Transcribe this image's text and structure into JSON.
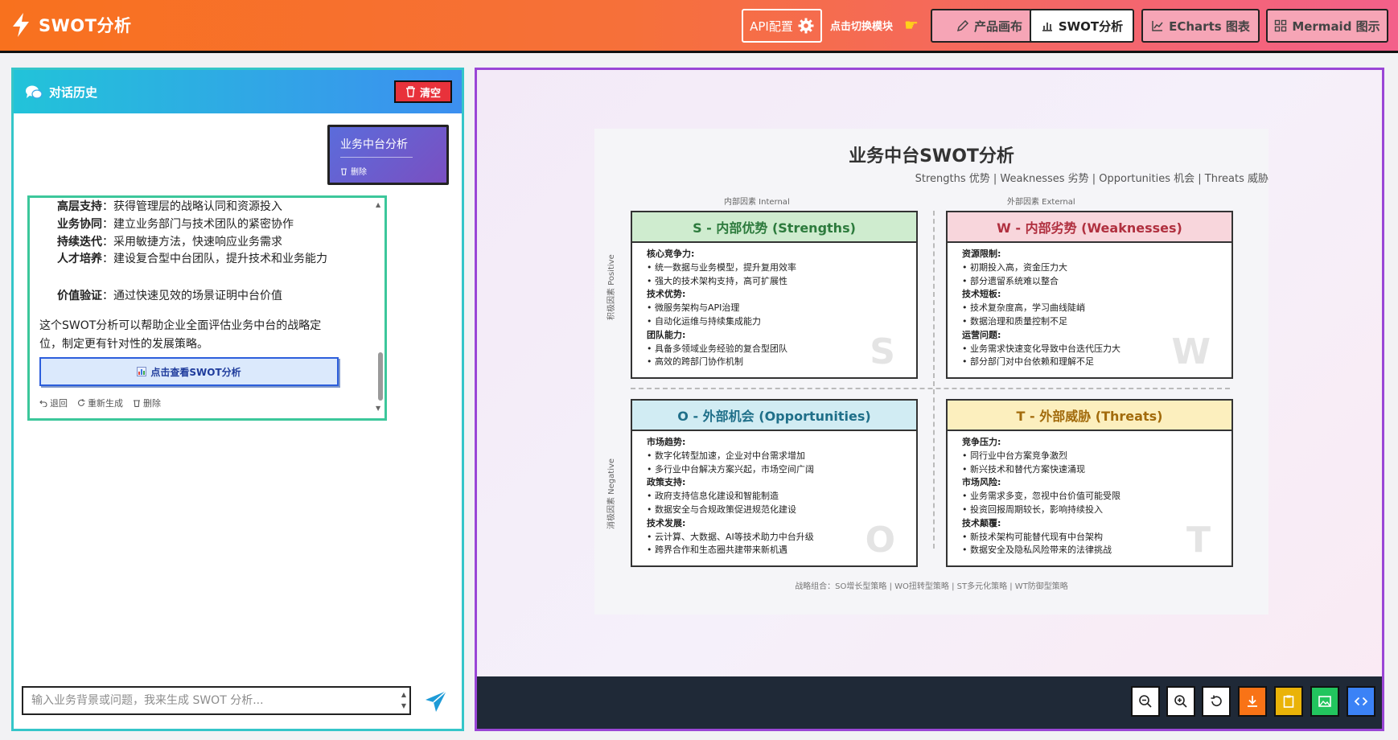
{
  "header": {
    "title": "SWOT分析",
    "api_label": "API配置",
    "switch_label": "点击切换模块",
    "tabs": [
      {
        "label": "产品画布",
        "active": false
      },
      {
        "label": "SWOT分析",
        "active": true
      },
      {
        "label": "ECharts 图表",
        "active": false
      },
      {
        "label": "Mermaid 图示",
        "active": false
      }
    ]
  },
  "chat": {
    "title": "对话历史",
    "clear_label": "清空",
    "user_message": {
      "text": "业务中台分析",
      "delete_label": "删除"
    },
    "ai_message": {
      "points": [
        {
          "label": "高层支持",
          "text": "获得管理层的战略认同和资源投入"
        },
        {
          "label": "业务协同",
          "text": "建立业务部门与技术团队的紧密协作"
        },
        {
          "label": "持续迭代",
          "text": "采用敏捷方法，快速响应业务需求"
        },
        {
          "label": "人才培养",
          "text": "建设复合型中台团队，提升技术和业务能力"
        },
        {
          "label": "价值验证",
          "text": "通过快速见效的场景证明中台价值"
        }
      ],
      "summary": "这个SWOT分析可以帮助企业全面评估业务中台的战略定位，制定更有针对性的发展策略。",
      "view_button": "点击查看SWOT分析",
      "actions": [
        "退回",
        "重新生成",
        "删除"
      ]
    },
    "input_placeholder": "输入业务背景或问题，我来生成 SWOT 分析...",
    "input_value": ""
  },
  "swot": {
    "title": "业务中台SWOT分析",
    "subtitle": "Strengths 优势 | Weaknesses 劣势 | Opportunities 机会 | Threats 威胁",
    "axis_internal": "内部因素 Internal",
    "axis_external": "外部因素 External",
    "axis_positive": "积极因素 Positive",
    "axis_negative": "消极因素 Negative",
    "strengths": {
      "title": "S - 内部优势 (Strengths)",
      "letter": "S",
      "groups": [
        {
          "name": "核心竞争力:",
          "items": [
            "统一数据与业务模型，提升复用效率",
            "强大的技术架构支持，高可扩展性"
          ]
        },
        {
          "name": "技术优势:",
          "items": [
            "微服务架构与API治理",
            "自动化运维与持续集成能力"
          ]
        },
        {
          "name": "团队能力:",
          "items": [
            "具备多领域业务经验的复合型团队",
            "高效的跨部门协作机制"
          ]
        }
      ]
    },
    "weaknesses": {
      "title": "W - 内部劣势 (Weaknesses)",
      "letter": "W",
      "groups": [
        {
          "name": "资源限制:",
          "items": [
            "初期投入高，资金压力大",
            "部分遗留系统难以整合"
          ]
        },
        {
          "name": "技术短板:",
          "items": [
            "技术复杂度高，学习曲线陡峭",
            "数据治理和质量控制不足"
          ]
        },
        {
          "name": "运营问题:",
          "items": [
            "业务需求快速变化导致中台迭代压力大",
            "部分部门对中台依赖和理解不足"
          ]
        }
      ]
    },
    "opportunities": {
      "title": "O - 外部机会 (Opportunities)",
      "letter": "O",
      "groups": [
        {
          "name": "市场趋势:",
          "items": [
            "数字化转型加速，企业对中台需求增加",
            "多行业中台解决方案兴起，市场空间广阔"
          ]
        },
        {
          "name": "政策支持:",
          "items": [
            "政府支持信息化建设和智能制造",
            "数据安全与合规政策促进规范化建设"
          ]
        },
        {
          "name": "技术发展:",
          "items": [
            "云计算、大数据、AI等技术助力中台升级",
            "跨界合作和生态圈共建带来新机遇"
          ]
        }
      ]
    },
    "threats": {
      "title": "T - 外部威胁 (Threats)",
      "letter": "T",
      "groups": [
        {
          "name": "竞争压力:",
          "items": [
            "同行业中台方案竞争激烈",
            "新兴技术和替代方案快速涌现"
          ]
        },
        {
          "name": "市场风险:",
          "items": [
            "业务需求多变，忽视中台价值可能受限",
            "投资回报周期较长，影响持续投入"
          ]
        },
        {
          "name": "技术颠覆:",
          "items": [
            "新技术架构可能替代现有中台架构",
            "数据安全及隐私风险带来的法律挑战"
          ]
        }
      ]
    },
    "strategy_note": "战略组合：SO增长型策略 | WO扭转型策略 | ST多元化策略 | WT防御型策略"
  },
  "colors": {
    "header_start": "#f8711e",
    "header_end": "#f3608a",
    "chat_border": "#35c6c9",
    "canvas_border": "#9a47d6",
    "toolbar_bg": "#1f2937"
  },
  "toolbar_icons": [
    "zoom-out-icon",
    "zoom-in-icon",
    "reset-icon",
    "download-icon",
    "clipboard-icon",
    "image-icon",
    "code-icon"
  ]
}
